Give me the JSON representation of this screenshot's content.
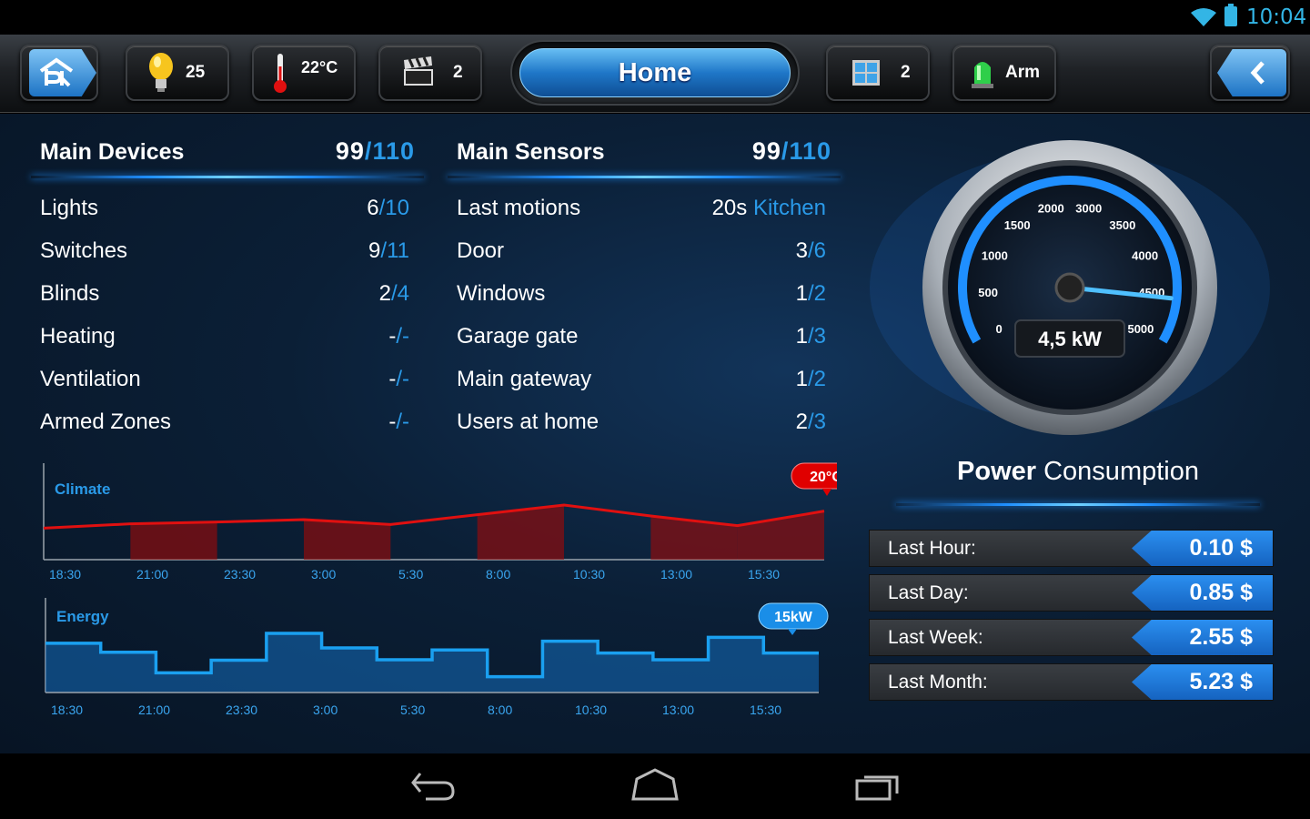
{
  "status_bar": {
    "time": "10:04"
  },
  "toolbar": {
    "lights_count": "25",
    "temperature": "22°C",
    "scenes_count": "2",
    "home_label": "Home",
    "windows_count": "2",
    "alarm_label": "Arm"
  },
  "main_devices": {
    "title": "Main Devices",
    "count_active": "99",
    "count_total": "110",
    "items": [
      {
        "label": "Lights",
        "active": "6",
        "total": "10"
      },
      {
        "label": "Switches",
        "active": "9",
        "total": "11"
      },
      {
        "label": "Blinds",
        "active": "2",
        "total": "4"
      },
      {
        "label": "Heating",
        "active": "-",
        "total": "-"
      },
      {
        "label": "Ventilation",
        "active": "-",
        "total": "-"
      },
      {
        "label": "Armed Zones",
        "active": "-",
        "total": "-"
      }
    ]
  },
  "main_sensors": {
    "title": "Main Sensors",
    "count_active": "99",
    "count_total": "110",
    "items": [
      {
        "label": "Last motions",
        "active": "20s",
        "total": "Kitchen",
        "sep": " "
      },
      {
        "label": "Door",
        "active": "3",
        "total": "6",
        "sep": "/"
      },
      {
        "label": "Windows",
        "active": "1",
        "total": "2",
        "sep": "/"
      },
      {
        "label": "Garage gate",
        "active": "1",
        "total": "3",
        "sep": "/"
      },
      {
        "label": "Main gateway",
        "active": "1",
        "total": "2",
        "sep": "/"
      },
      {
        "label": "Users at home",
        "active": "2",
        "total": "3",
        "sep": "/"
      }
    ]
  },
  "chart_data": [
    {
      "type": "line",
      "title": "Climate",
      "categories": [
        "18:30",
        "21:00",
        "23:30",
        "3:00",
        "5:30",
        "8:00",
        "10:30",
        "13:00",
        "15:30"
      ],
      "series": [
        {
          "values": [
            17.2,
            17.9,
            18.2,
            18.6,
            17.8,
            19.4,
            21.0,
            19.2,
            17.6,
            20.0
          ]
        }
      ],
      "current_label": "20°C",
      "ylim": [
        12,
        24
      ],
      "color": "#e01010"
    },
    {
      "type": "area",
      "title": "Energy",
      "categories": [
        "18:30",
        "21:00",
        "23:30",
        "3:00",
        "5:30",
        "8:00",
        "10:30",
        "13:00",
        "15:30"
      ],
      "series": [
        {
          "values": [
            12.5,
            10.2,
            5.0,
            8.2,
            15.0,
            11.3,
            8.3,
            10.8,
            4.0,
            13.0,
            10.0,
            8.3,
            14.0,
            10.0
          ]
        }
      ],
      "current_label": "15kW",
      "ylim": [
        0,
        18
      ],
      "color": "#1aa0f0"
    }
  ],
  "gauge": {
    "value": 4.5,
    "display": "4,5 kW",
    "ticks": [
      "0",
      "500",
      "1000",
      "1500",
      "2000",
      "3000",
      "3500",
      "4000",
      "4500",
      "5000"
    ]
  },
  "power": {
    "title_bold": "Power",
    "title_rest": "Consumption",
    "rows": [
      {
        "label": "Last Hour:",
        "value": "0.10 $"
      },
      {
        "label": "Last Day:",
        "value": "0.85 $"
      },
      {
        "label": "Last Week:",
        "value": "2.55 $"
      },
      {
        "label": "Last Month:",
        "value": "5.23 $"
      }
    ]
  },
  "colors": {
    "accent": "#2a9ae8",
    "climate": "#e01010",
    "energy": "#1aa0f0",
    "bg": "#0b1f36"
  }
}
